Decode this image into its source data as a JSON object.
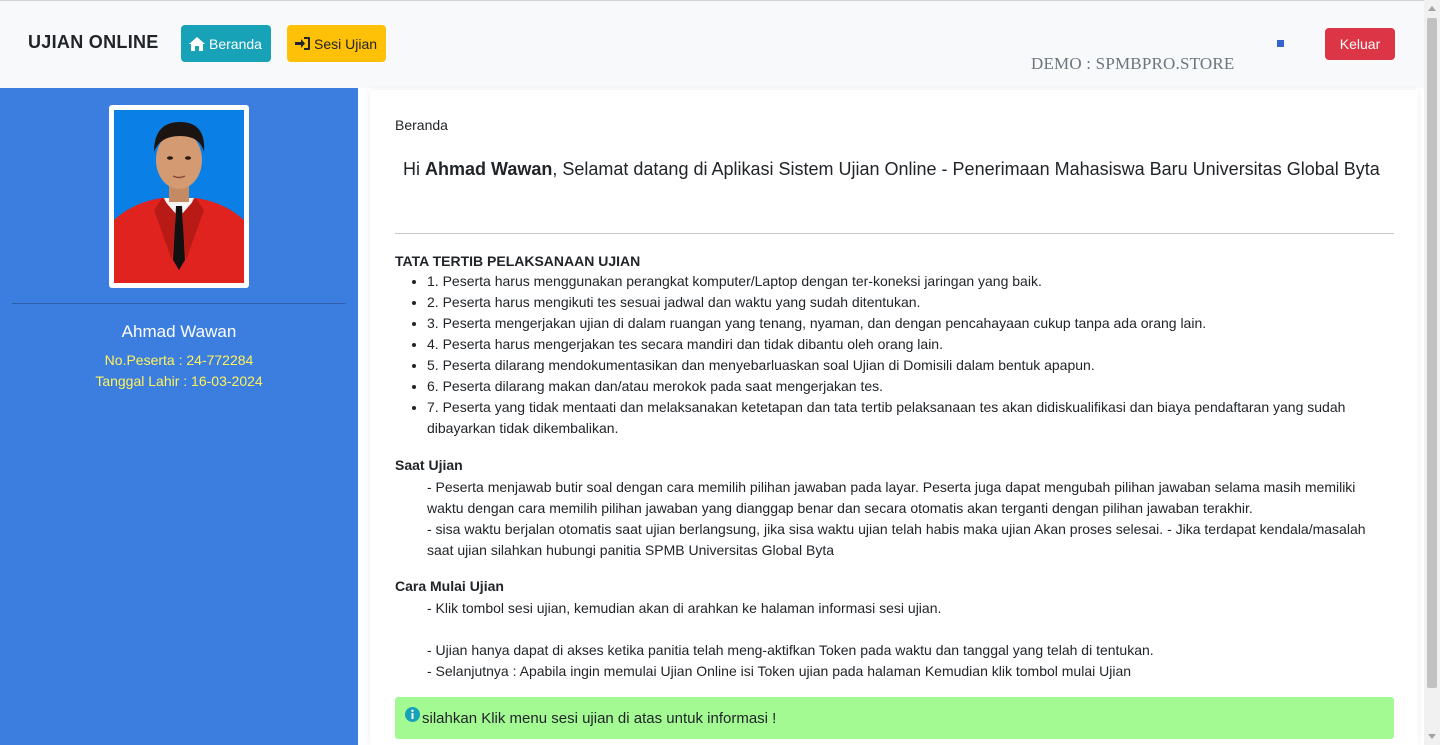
{
  "navbar": {
    "brand": "UJIAN ONLINE",
    "home_label": "Beranda",
    "session_label": "Sesi Ujian",
    "demo_text": "DEMO  : SPMBPRO.STORE",
    "logout_label": "Keluar"
  },
  "sidebar": {
    "name": "Ahmad Wawan",
    "participant_no": "No.Peserta : 24-772284",
    "birth_date": "Tanggal Lahir : 16-03-2024"
  },
  "main": {
    "breadcrumb": "Beranda",
    "welcome_prefix": "Hi ",
    "welcome_name": "Ahmad Wawan",
    "welcome_suffix": ", Selamat datang di Aplikasi Sistem Ujian Online - Penerimaan Mahasiswa Baru Universitas Global Byta",
    "rules_title": "TATA TERTIB PELAKSANAAN UJIAN",
    "rules": [
      "1. Peserta harus menggunakan perangkat komputer/Laptop dengan ter-koneksi jaringan yang baik.",
      "2. Peserta harus mengikuti tes sesuai jadwal dan waktu yang sudah ditentukan.",
      "3. Peserta mengerjakan ujian di dalam ruangan yang tenang, nyaman, dan dengan pencahayaan cukup tanpa ada orang lain.",
      "4. Peserta harus mengerjakan tes secara mandiri dan tidak dibantu oleh orang lain.",
      "5. Peserta dilarang mendokumentasikan dan menyebarluaskan soal Ujian di Domisili dalam bentuk apapun.",
      "6. Peserta dilarang makan dan/atau merokok pada saat mengerjakan tes.",
      "7. Peserta yang tidak mentaati dan melaksanakan ketetapan dan tata tertib pelaksanaan tes akan didiskualifikasi dan biaya pendaftaran yang sudah dibayarkan tidak dikembalikan."
    ],
    "during_title": "Saat Ujian",
    "during_p1": "- Peserta menjawab butir soal dengan cara memilih pilihan jawaban pada layar. Peserta juga dapat mengubah pilihan jawaban selama masih memiliki waktu dengan cara memilih pilihan jawaban yang dianggap benar dan secara otomatis akan terganti dengan pilihan jawaban terakhir.",
    "during_p2": "- sisa waktu berjalan otomatis saat ujian berlangsung, jika sisa waktu ujian telah habis maka ujian Akan proses selesai. - Jika terdapat kendala/masalah saat ujian silahkan hubungi panitia SPMB Universitas Global Byta",
    "start_title": "Cara Mulai Ujian",
    "start_l1": "- Klik tombol sesi ujian, kemudian akan di arahkan ke halaman informasi sesi ujian.",
    "start_l2": "- Ujian hanya dapat di akses ketika panitia telah meng-aktifkan Token pada waktu dan tanggal yang telah di tentukan.",
    "start_l3": "- Selanjutnya : Apabila ingin memulai Ujian Online isi Token ujian pada halaman Kemudian klik tombol mulai Ujian",
    "alert_text": "silahkan Klik menu sesi ujian di atas untuk informasi !"
  },
  "icons": {
    "home": "home-icon",
    "session": "sign-in-icon",
    "info": "info-circle-icon"
  },
  "colors": {
    "sidebar_bg": "#3c7de0",
    "home_btn": "#17a2b8",
    "session_btn": "#ffc107",
    "logout_btn": "#dc3545",
    "alert_bg": "#a3fa93",
    "sidebar_info": "#fff35c"
  }
}
